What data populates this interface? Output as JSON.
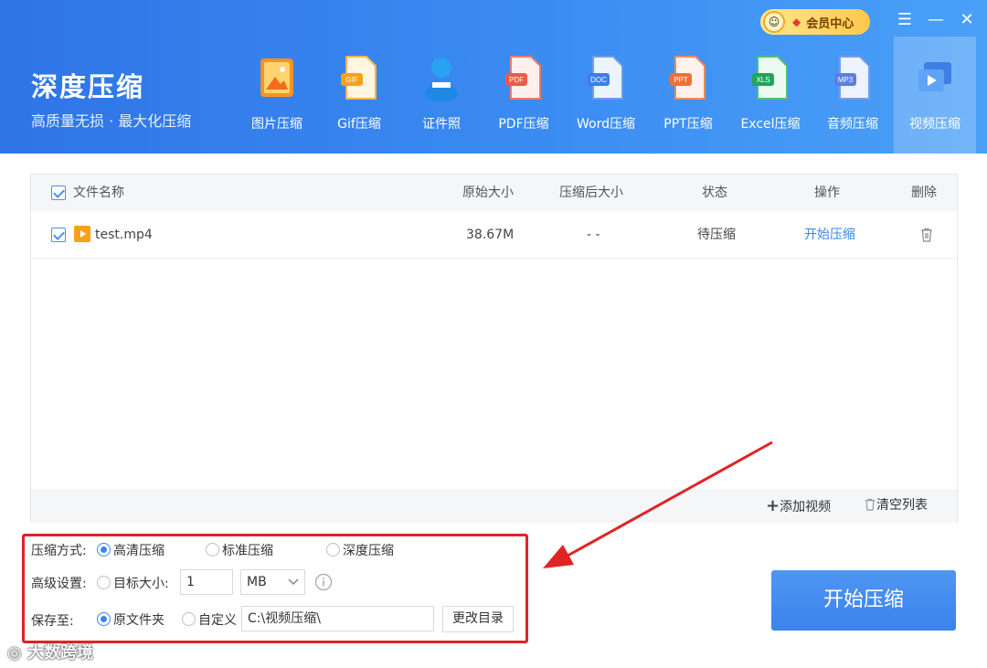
{
  "header": {
    "title": "深度压缩",
    "subtitle": "高质量无损 · 最大化压缩",
    "vip_label": "会员中心",
    "tools": [
      {
        "label": "图片压缩",
        "icon": "image-icon"
      },
      {
        "label": "Gif压缩",
        "icon": "gif-file-icon",
        "badge": "GIF"
      },
      {
        "label": "证件照",
        "icon": "id-photo-icon"
      },
      {
        "label": "PDF压缩",
        "icon": "pdf-file-icon",
        "badge": "PDF"
      },
      {
        "label": "Word压缩",
        "icon": "word-file-icon",
        "badge": "DOC"
      },
      {
        "label": "PPT压缩",
        "icon": "ppt-file-icon",
        "badge": "PPT"
      },
      {
        "label": "Excel压缩",
        "icon": "excel-file-icon",
        "badge": "XLS"
      },
      {
        "label": "音频压缩",
        "icon": "audio-file-icon",
        "badge": "MP3"
      },
      {
        "label": "视频压缩",
        "icon": "video-icon",
        "active": true
      }
    ]
  },
  "table": {
    "columns": [
      "文件名称",
      "原始大小",
      "压缩后大小",
      "状态",
      "操作",
      "删除"
    ],
    "rows": [
      {
        "name": "test.mp4",
        "original": "38.67M",
        "compressed": "- -",
        "status": "待压缩",
        "action": "开始压缩"
      }
    ],
    "footer": {
      "add": "添加视频",
      "clear": "清空列表"
    }
  },
  "settings": {
    "mode_label": "压缩方式:",
    "modes": [
      "高清压缩",
      "标准压缩",
      "深度压缩"
    ],
    "advanced_label": "高级设置:",
    "target_label": "目标大小:",
    "target_value": "1",
    "unit_value": "MB",
    "save_label": "保存至:",
    "save_options": [
      "原文件夹",
      "自定义"
    ],
    "path_value": "C:\\视频压缩\\",
    "change_dir": "更改目录"
  },
  "start_button": "开始压缩",
  "watermark": "大数跨境",
  "colors": {
    "header": "#3b8cf2",
    "accent": "#3a86ea",
    "highlight_box": "#e02424"
  }
}
